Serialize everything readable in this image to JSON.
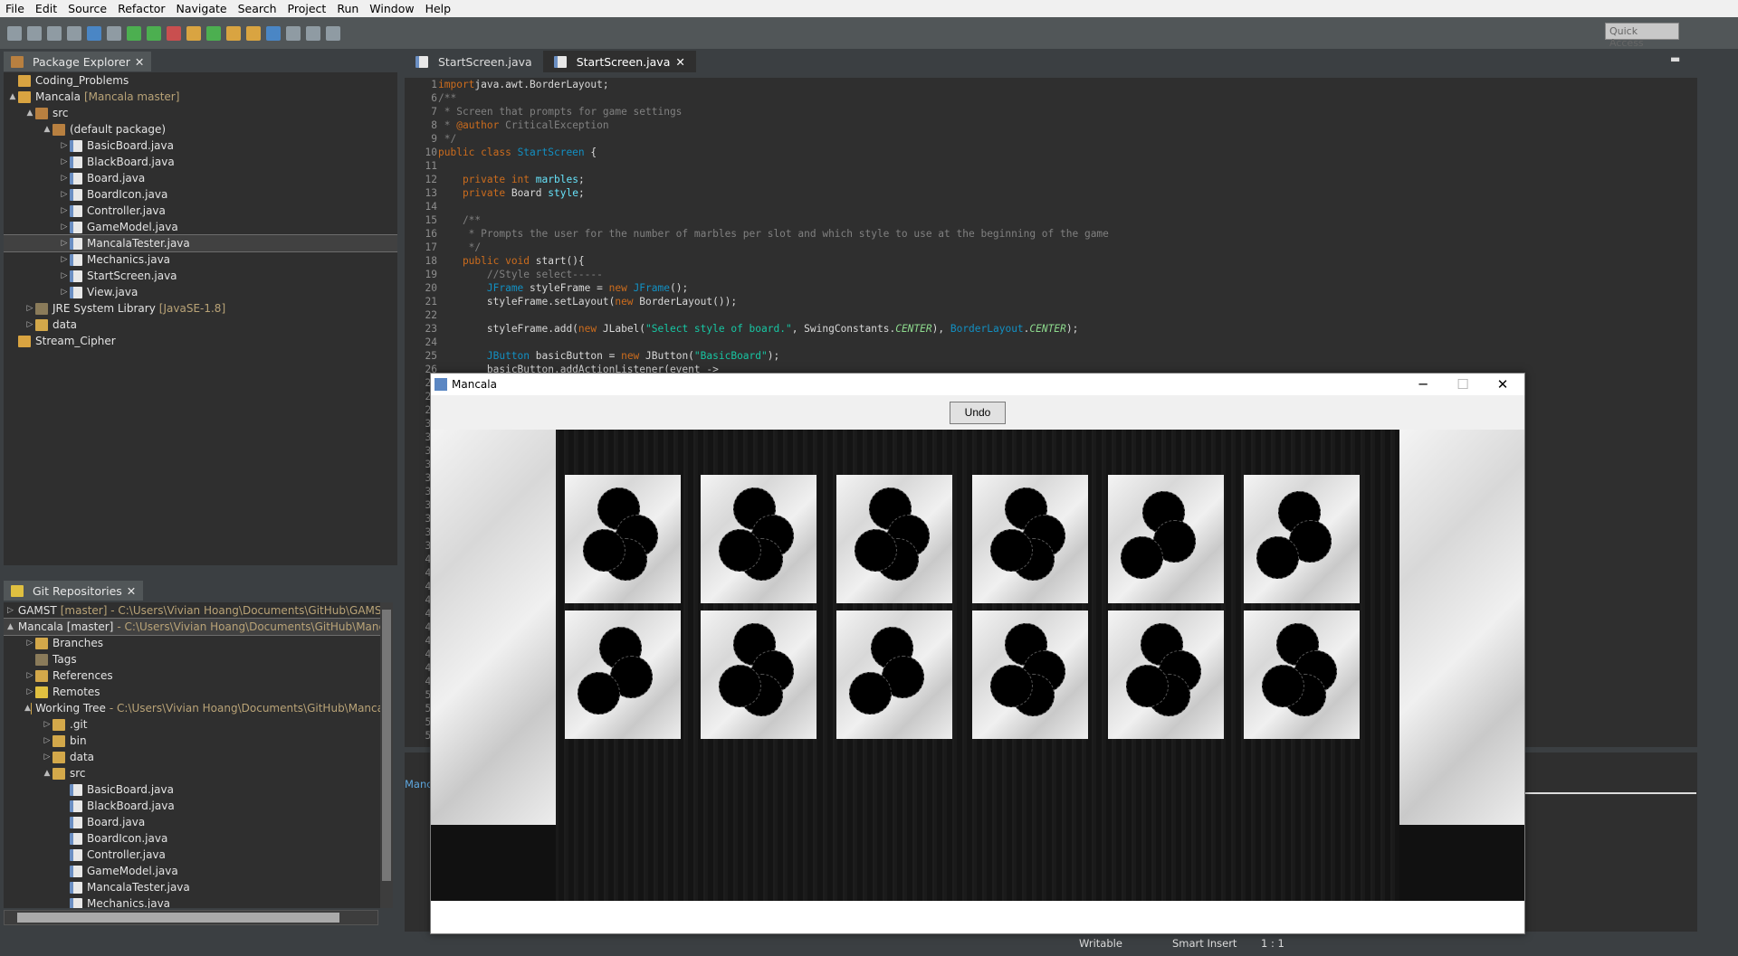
{
  "menu": [
    "File",
    "Edit",
    "Source",
    "Refactor",
    "Navigate",
    "Search",
    "Project",
    "Run",
    "Window",
    "Help"
  ],
  "toolbar": {
    "quick_access": "Quick Access"
  },
  "package_explorer": {
    "title": "Package Explorer",
    "items": [
      {
        "label": "Coding_Problems",
        "extra": "",
        "indent": 0,
        "icon": "project",
        "arrow": ""
      },
      {
        "label": "Mancala",
        "extra": "[Mancala master]",
        "indent": 0,
        "icon": "project",
        "arrow": "▲"
      },
      {
        "label": "src",
        "extra": "",
        "indent": 1,
        "icon": "package-folder",
        "arrow": "▲"
      },
      {
        "label": "(default package)",
        "extra": "",
        "indent": 2,
        "icon": "package",
        "arrow": "▲"
      },
      {
        "label": "BasicBoard.java",
        "extra": "",
        "indent": 3,
        "icon": "java",
        "arrow": "▷"
      },
      {
        "label": "BlackBoard.java",
        "extra": "",
        "indent": 3,
        "icon": "java",
        "arrow": "▷"
      },
      {
        "label": "Board.java",
        "extra": "",
        "indent": 3,
        "icon": "java",
        "arrow": "▷"
      },
      {
        "label": "BoardIcon.java",
        "extra": "",
        "indent": 3,
        "icon": "java",
        "arrow": "▷"
      },
      {
        "label": "Controller.java",
        "extra": "",
        "indent": 3,
        "icon": "java",
        "arrow": "▷"
      },
      {
        "label": "GameModel.java",
        "extra": "",
        "indent": 3,
        "icon": "java",
        "arrow": "▷"
      },
      {
        "label": "MancalaTester.java",
        "extra": "",
        "indent": 3,
        "icon": "java",
        "arrow": "▷",
        "selected": true
      },
      {
        "label": "Mechanics.java",
        "extra": "",
        "indent": 3,
        "icon": "java",
        "arrow": "▷"
      },
      {
        "label": "StartScreen.java",
        "extra": "",
        "indent": 3,
        "icon": "java",
        "arrow": "▷"
      },
      {
        "label": "View.java",
        "extra": "",
        "indent": 3,
        "icon": "java",
        "arrow": "▷"
      },
      {
        "label": "JRE System Library",
        "extra": "[JavaSE-1.8]",
        "indent": 1,
        "icon": "library",
        "arrow": "▷"
      },
      {
        "label": "data",
        "extra": "",
        "indent": 1,
        "icon": "folder",
        "arrow": "▷"
      },
      {
        "label": "Stream_Cipher",
        "extra": "",
        "indent": 0,
        "icon": "project",
        "arrow": ""
      }
    ]
  },
  "git": {
    "title": "Git Repositories",
    "items": [
      {
        "label": "GAMST",
        "extra": "[master] - C:\\Users\\Vivian Hoang\\Documents\\GitHub\\GAMST",
        "indent": 0,
        "icon": "repo",
        "arrow": "▷"
      },
      {
        "label": "Mancala [master]",
        "extra": "- C:\\Users\\Vivian Hoang\\Documents\\GitHub\\Manca",
        "indent": 0,
        "icon": "repo",
        "arrow": "▲",
        "selected": true
      },
      {
        "label": "Branches",
        "extra": "",
        "indent": 1,
        "icon": "folder",
        "arrow": "▷"
      },
      {
        "label": "Tags",
        "extra": "",
        "indent": 1,
        "icon": "tag",
        "arrow": ""
      },
      {
        "label": "References",
        "extra": "",
        "indent": 1,
        "icon": "folder",
        "arrow": "▷"
      },
      {
        "label": "Remotes",
        "extra": "",
        "indent": 1,
        "icon": "repo",
        "arrow": "▷"
      },
      {
        "label": "Working Tree",
        "extra": "- C:\\Users\\Vivian Hoang\\Documents\\GitHub\\Manca",
        "indent": 1,
        "icon": "folder",
        "arrow": "▲"
      },
      {
        "label": ".git",
        "extra": "",
        "indent": 2,
        "icon": "folder",
        "arrow": "▷"
      },
      {
        "label": "bin",
        "extra": "",
        "indent": 2,
        "icon": "folder",
        "arrow": "▷"
      },
      {
        "label": "data",
        "extra": "",
        "indent": 2,
        "icon": "folder",
        "arrow": "▷"
      },
      {
        "label": "src",
        "extra": "",
        "indent": 2,
        "icon": "folder",
        "arrow": "▲"
      },
      {
        "label": "BasicBoard.java",
        "extra": "",
        "indent": 3,
        "icon": "java",
        "arrow": ""
      },
      {
        "label": "BlackBoard.java",
        "extra": "",
        "indent": 3,
        "icon": "java",
        "arrow": ""
      },
      {
        "label": "Board.java",
        "extra": "",
        "indent": 3,
        "icon": "java",
        "arrow": ""
      },
      {
        "label": "BoardIcon.java",
        "extra": "",
        "indent": 3,
        "icon": "java",
        "arrow": ""
      },
      {
        "label": "Controller.java",
        "extra": "",
        "indent": 3,
        "icon": "java",
        "arrow": ""
      },
      {
        "label": "GameModel.java",
        "extra": "",
        "indent": 3,
        "icon": "java",
        "arrow": ""
      },
      {
        "label": "MancalaTester.java",
        "extra": "",
        "indent": 3,
        "icon": "java",
        "arrow": ""
      },
      {
        "label": "Mechanics.java",
        "extra": "",
        "indent": 3,
        "icon": "java",
        "arrow": ""
      }
    ]
  },
  "editor": {
    "tabs": [
      {
        "label": "StartScreen.java",
        "active": false
      },
      {
        "label": "StartScreen.java",
        "active": true
      }
    ],
    "line_numbers": [
      "1",
      "6",
      "7",
      "8",
      "9",
      "10",
      "11",
      "12",
      "13",
      "14",
      "15",
      "16",
      "17",
      "18",
      "19",
      "20",
      "21",
      "22",
      "23",
      "24",
      "25",
      "26",
      "27",
      "28",
      "29",
      "30",
      "31",
      "32",
      "33",
      "34",
      "35",
      "36",
      "37",
      "38",
      "39",
      "40",
      "41",
      "42",
      "43",
      "44",
      "45",
      "46",
      "47",
      "48",
      "49",
      "50",
      "51",
      "52",
      "53"
    ],
    "lines": [
      [
        [
          "kw",
          "import"
        ],
        [
          "",
          "java.awt.BorderLayout;"
        ]
      ],
      [
        [
          "cm",
          "/**"
        ]
      ],
      [
        [
          "cm",
          " * Screen that prompts for game settings"
        ]
      ],
      [
        [
          "cm",
          " * "
        ],
        [
          "kw",
          "@author"
        ],
        [
          "cm",
          " CriticalException"
        ]
      ],
      [
        [
          "cm",
          " */"
        ]
      ],
      [
        [
          "kw",
          "public class "
        ],
        [
          "ty",
          "StartScreen"
        ],
        [
          "",
          " {"
        ]
      ],
      [
        [
          "",
          ""
        ]
      ],
      [
        [
          "kw",
          "    private int "
        ],
        [
          "fd",
          "marbles"
        ],
        [
          "",
          ";"
        ]
      ],
      [
        [
          "kw",
          "    private "
        ],
        [
          "",
          "Board "
        ],
        [
          "fd",
          "style"
        ],
        [
          "",
          ";"
        ]
      ],
      [
        [
          "",
          ""
        ]
      ],
      [
        [
          "cm",
          "    /**"
        ]
      ],
      [
        [
          "cm",
          "     * Prompts the user for the number of marbles per slot and which style to use at the beginning of the game"
        ]
      ],
      [
        [
          "cm",
          "     */"
        ]
      ],
      [
        [
          "kw",
          "    public void "
        ],
        [
          "",
          "start(){"
        ]
      ],
      [
        [
          "cm",
          "        //Style select-----"
        ]
      ],
      [
        [
          "ty",
          "        JFrame "
        ],
        [
          "",
          "styleFrame = "
        ],
        [
          "kw",
          "new "
        ],
        [
          "ty",
          "JFrame"
        ],
        [
          "",
          "();"
        ]
      ],
      [
        [
          "",
          "        styleFrame.setLayout("
        ],
        [
          "kw",
          "new "
        ],
        [
          "",
          "BorderLayout());"
        ]
      ],
      [
        [
          "",
          ""
        ]
      ],
      [
        [
          "",
          "        styleFrame.add("
        ],
        [
          "kw",
          "new "
        ],
        [
          "",
          "JLabel("
        ],
        [
          "st",
          "\"Select style of board.\""
        ],
        [
          "",
          ", SwingConstants."
        ],
        [
          "it",
          "CENTER"
        ],
        [
          "",
          "), "
        ],
        [
          "ty",
          "BorderLayout"
        ],
        [
          "",
          "."
        ],
        [
          "it",
          "CENTER"
        ],
        [
          "",
          ");"
        ]
      ],
      [
        [
          "",
          ""
        ]
      ],
      [
        [
          "ty",
          "        JButton "
        ],
        [
          "",
          "basicButton = "
        ],
        [
          "kw",
          "new "
        ],
        [
          "",
          "JButton("
        ],
        [
          "st",
          "\"BasicBoard\""
        ],
        [
          "",
          ");"
        ]
      ],
      [
        [
          "",
          "        basicButton.addActionListener(event ->"
        ]
      ]
    ]
  },
  "status": {
    "writable": "Writable",
    "insert_mode": "Smart Insert",
    "position": "1 : 1"
  },
  "mancala_window": {
    "title": "Mancala",
    "undo_label": "Undo",
    "top_row_marbles": [
      4,
      4,
      4,
      4,
      3,
      3
    ],
    "bottom_row_marbles": [
      3,
      4,
      3,
      4,
      4,
      4
    ]
  },
  "bottom_panel": {
    "tab_fragment": "Manca"
  }
}
